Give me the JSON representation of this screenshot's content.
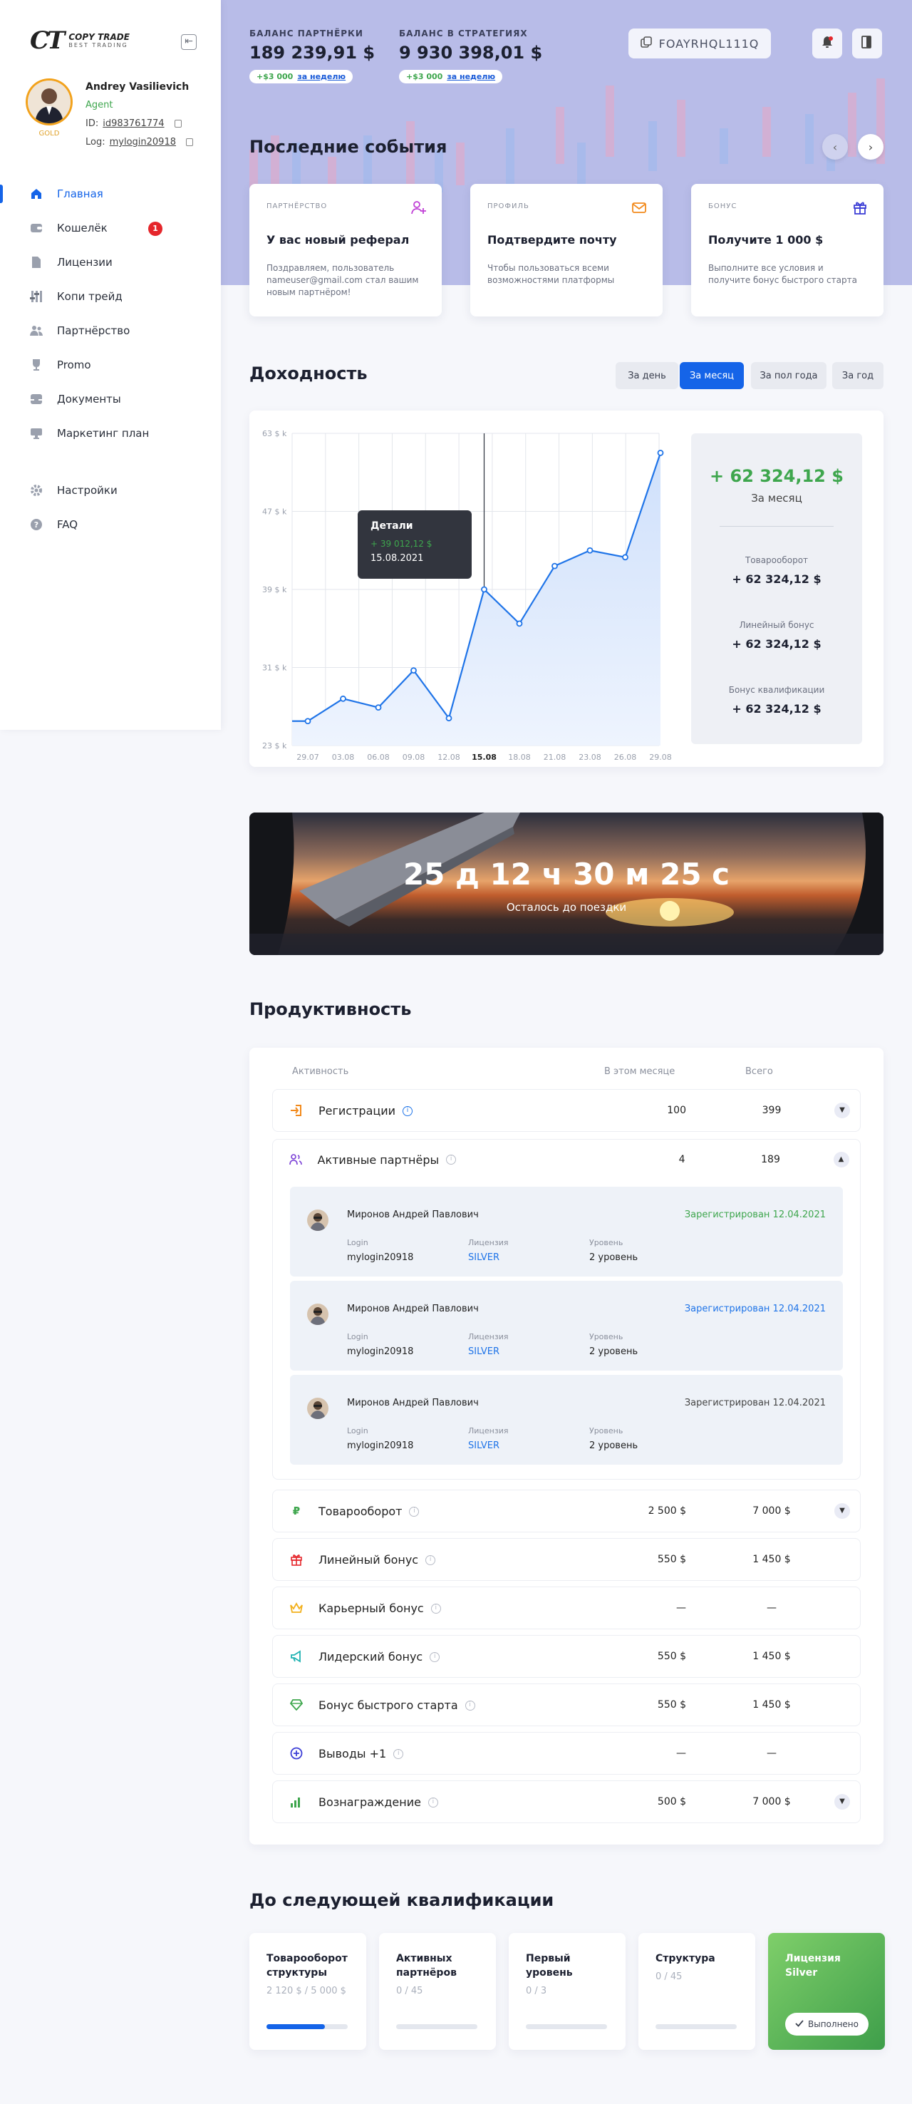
{
  "logo": {
    "mark": "CT",
    "title": "COPY TRADE",
    "subtitle": "BEST TRADING"
  },
  "user": {
    "name": "Andrey Vasilievich",
    "role": "Agent",
    "rank": "GOLD",
    "id_label": "ID:",
    "id": "id983761774",
    "login_label": "Log:",
    "login": "mylogin20918"
  },
  "nav": {
    "items": [
      {
        "label": "Главная",
        "icon": "home-icon"
      },
      {
        "label": "Кошелёк",
        "icon": "wallet-icon",
        "badge": "1"
      },
      {
        "label": "Лицензии",
        "icon": "document-icon"
      },
      {
        "label": "Копи трейд",
        "icon": "sliders-icon"
      },
      {
        "label": "Партнёрство",
        "icon": "users-icon"
      },
      {
        "label": "Promo",
        "icon": "trophy-icon"
      },
      {
        "label": "Документы",
        "icon": "inbox-icon"
      },
      {
        "label": "Маркетинг план",
        "icon": "monitor-icon"
      }
    ],
    "settings": {
      "label": "Настройки",
      "icon": "gear-icon"
    },
    "faq": {
      "label": "FAQ",
      "icon": "help-icon"
    }
  },
  "balances": {
    "partner": {
      "label": "БАЛАНС ПАРТНЁРКИ",
      "value": "189 239,91 $",
      "delta": "+$3 000",
      "link": "за неделю"
    },
    "strategies": {
      "label": "БАЛАНС В СТРАТЕГИЯХ",
      "value": "9 930 398,01 $",
      "delta": "+$3 000",
      "link": "за неделю"
    }
  },
  "promo_code": "FOAYRHQL111Q",
  "events": {
    "title": "Последние события",
    "cards": [
      {
        "tag": "ПАРТНЁРСТВО",
        "title": "У вас новый реферал",
        "text": "Поздравляем, пользователь nameuser@gmail.com стал вашим новым партнёром!",
        "icon": "user-plus-icon",
        "color": "#c03fd6"
      },
      {
        "tag": "ПРОФИЛЬ",
        "title": "Подтвердите почту",
        "text": "Чтобы пользоваться всеми возможностями платформы",
        "icon": "mail-icon",
        "color": "#f28a1c"
      },
      {
        "tag": "БОНУС",
        "title": "Получите 1 000 $",
        "text": "Выполните все условия и получите бонус быстрого старта",
        "icon": "gift-icon",
        "color": "#3d3fd6"
      }
    ]
  },
  "income": {
    "title": "Доходность",
    "periods": [
      "За день",
      "За месяц",
      "За пол года",
      "За год"
    ],
    "active_period": "За месяц",
    "total": "+ 62 324,12 $",
    "total_label": "За месяц",
    "stats": [
      {
        "label": "Товарооборот",
        "value": "+ 62 324,12 $"
      },
      {
        "label": "Линейный бонус",
        "value": "+ 62 324,12 $"
      },
      {
        "label": "Бонус квалификации",
        "value": "+ 62 324,12 $"
      }
    ],
    "tooltip": {
      "title": "Детали",
      "value": "+ 39 012,12 $",
      "date": "15.08.2021"
    }
  },
  "chart_data": {
    "type": "area",
    "x": [
      "29.07",
      "03.08",
      "06.08",
      "09.08",
      "12.08",
      "15.08",
      "18.08",
      "21.08",
      "23.08",
      "26.08",
      "29.08"
    ],
    "y_tick_labels": [
      "63 $ k",
      "47 $ k",
      "39 $ k",
      "31 $ k",
      "23 $ k"
    ],
    "y_ticks": [
      63,
      47,
      39,
      31,
      23
    ],
    "values": [
      25.5,
      27.8,
      26.9,
      30.7,
      25.8,
      39,
      35.5,
      41.4,
      43,
      42.3,
      59
    ],
    "start_value": 25.5,
    "highlight": "15.08",
    "grid": true,
    "color": "#1f74e8"
  },
  "countdown": {
    "value": "25 д 12 ч 30 м 25 с",
    "label": "Осталось до поездки"
  },
  "productivity": {
    "title": "Продуктивность",
    "headers": {
      "activity": "Активность",
      "month": "В этом месяце",
      "total": "Всего"
    },
    "rows": [
      {
        "label": "Регистрации",
        "month": "100",
        "total": "399",
        "icon": "sign-in-icon",
        "color": "#f28a1c"
      },
      {
        "label": "Активные партнёры",
        "month": "4",
        "total": "189",
        "icon": "users-icon",
        "color": "#7a3fd6"
      },
      {
        "label": "Товарооборот",
        "month": "2 500 $",
        "total": "7 000 $",
        "icon": "ruble-icon",
        "color": "#3ea64d"
      },
      {
        "label": "Линейный бонус",
        "month": "550 $",
        "total": "1 450 $",
        "icon": "gift-icon",
        "color": "#e5262b"
      },
      {
        "label": "Карьерный бонус",
        "month": "—",
        "total": "—",
        "icon": "crown-icon",
        "color": "#f2b01c"
      },
      {
        "label": "Лидерский бонус",
        "month": "550 $",
        "total": "1 450 $",
        "icon": "megaphone-icon",
        "color": "#21b3b3"
      },
      {
        "label": "Бонус быстрого старта",
        "month": "550 $",
        "total": "1 450 $",
        "icon": "diamond-icon",
        "color": "#3ea64d"
      },
      {
        "label": "Выводы +1",
        "month": "—",
        "total": "—",
        "icon": "plus-circle-icon",
        "color": "#3d3fd6"
      },
      {
        "label": "Вознаграждение",
        "month": "500 $",
        "total": "7 000 $",
        "icon": "bar-chart-icon",
        "color": "#3ea64d"
      }
    ],
    "partners": [
      {
        "name": "Миронов Андрей Павлович",
        "date": "Зарегистрирован 12.04.2021",
        "date_color": "#3ea64d",
        "login_label": "Login",
        "login": "mylogin20918",
        "license_label": "Лицензия",
        "license": "SILVER",
        "level_label": "Уровень",
        "level": "2 уровень"
      },
      {
        "name": "Миронов Андрей Павлович",
        "date": "Зарегистрирован 12.04.2021",
        "date_color": "#1f74e8",
        "login_label": "Login",
        "login": "mylogin20918",
        "license_label": "Лицензия",
        "license": "SILVER",
        "level_label": "Уровень",
        "level": "2 уровень"
      },
      {
        "name": "Миронов Андрей Павлович",
        "date": "Зарегистрирован 12.04.2021",
        "date_color": "#444444",
        "login_label": "Login",
        "login": "mylogin20918",
        "license_label": "Лицензия",
        "license": "SILVER",
        "level_label": "Уровень",
        "level": "2 уровень"
      }
    ]
  },
  "qualification": {
    "title": "До следующей квалификации",
    "cards": [
      {
        "title": "Товарооборот структуры",
        "progress": "2 120 $ / 5 000 $",
        "fraction": 0.72
      },
      {
        "title": "Активных партнёров",
        "progress": "0 / 45",
        "fraction": 0
      },
      {
        "title": "Первый уровень",
        "progress": "0 / 3",
        "fraction": 0
      },
      {
        "title": "Структура",
        "progress": "0 / 45",
        "fraction": 0
      }
    ],
    "done_card": {
      "title": "Лицензия Silver",
      "status": "Выполнено"
    }
  }
}
